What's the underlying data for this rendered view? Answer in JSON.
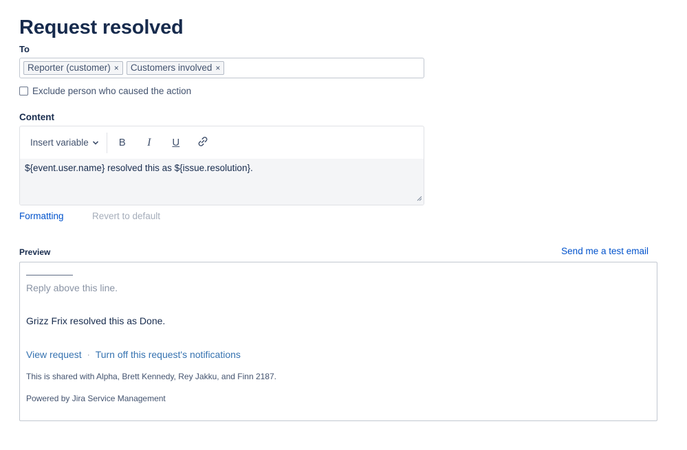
{
  "page": {
    "title": "Request resolved"
  },
  "to": {
    "label": "To",
    "recipients": [
      {
        "label": "Reporter (customer)",
        "remove_glyph": "×"
      },
      {
        "label": "Customers involved",
        "remove_glyph": "×"
      }
    ]
  },
  "exclude": {
    "label": "Exclude person who caused the action",
    "checked": false
  },
  "content": {
    "label": "Content",
    "toolbar": {
      "insert_variable_label": "Insert variable",
      "bold_label": "B",
      "italic_label": "I",
      "underline_label": "U",
      "link_icon": "link-icon",
      "dropdown_icon": "chevron-down-icon"
    },
    "body": "${event.user.name} resolved this as ${issue.resolution}."
  },
  "actions": {
    "formatting_label": "Formatting",
    "revert_label": "Revert to default"
  },
  "preview": {
    "label": "Preview",
    "send_test_label": "Send me a test email",
    "reply_line": "Reply above this line.",
    "message": "Grizz Frix resolved this as Done.",
    "view_request_label": "View request",
    "separator": "·",
    "turn_off_label": "Turn off this request's notifications",
    "shared_with": "This is shared with Alpha, Brett Kennedy, Rey Jakku, and Finn 2187.",
    "powered_by": "Powered by Jira Service Management"
  },
  "colors": {
    "link": "#0052cc",
    "title": "#172b4d",
    "muted": "#a5adba",
    "editor_bg": "#f4f5f7"
  }
}
